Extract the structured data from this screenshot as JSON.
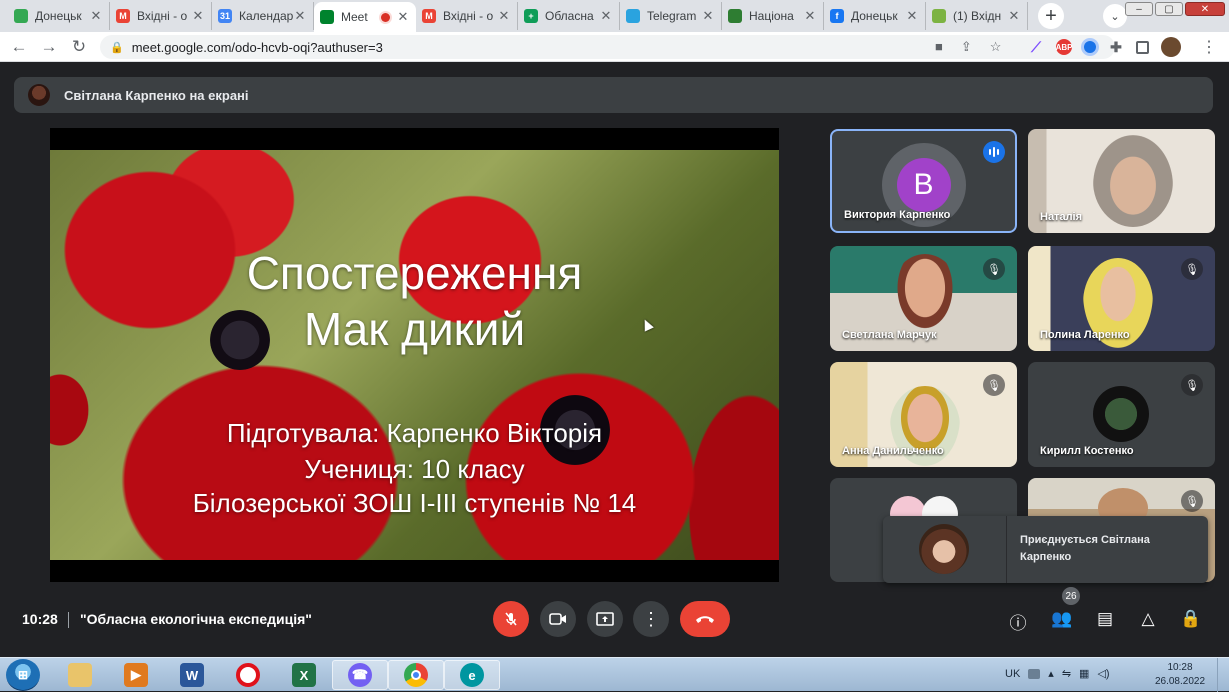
{
  "browser": {
    "tabs": [
      {
        "title": "Донецьк",
        "icon": "shield-favicon",
        "color": "#34a853",
        "glyph": ""
      },
      {
        "title": "Вхідні - о",
        "icon": "gmail-favicon",
        "color": "#ea4335",
        "glyph": "M"
      },
      {
        "title": "Календар",
        "icon": "calendar-favicon",
        "color": "#4285f4",
        "glyph": "31"
      },
      {
        "title": "Meet",
        "icon": "meet-favicon",
        "color": "#00832d",
        "glyph": "",
        "active": true
      },
      {
        "title": "Вхідні - о",
        "icon": "gmail-favicon",
        "color": "#ea4335",
        "glyph": "M"
      },
      {
        "title": "Обласна",
        "icon": "sheets-favicon",
        "color": "#0f9d58",
        "glyph": "+"
      },
      {
        "title": "Telegram",
        "icon": "telegram-favicon",
        "color": "#2aa3df",
        "glyph": ""
      },
      {
        "title": "Націона",
        "icon": "eco-favicon",
        "color": "#2e7d32",
        "glyph": ""
      },
      {
        "title": "Донецьк",
        "icon": "facebook-favicon",
        "color": "#1877f2",
        "glyph": "f"
      },
      {
        "title": "(1) Вхідн",
        "icon": "mail-favicon",
        "color": "#7cb342",
        "glyph": ""
      }
    ],
    "url": "meet.google.com/odo-hcvb-oqi?authuser=3"
  },
  "meet": {
    "banner": "Світлана Карпенко на екрані",
    "slide": {
      "title_line1": "Спостереження",
      "title_line2": "Мак дикий",
      "sub_line1": "Підготувала: Карпенко Вікторія",
      "sub_line2": "Учениця: 10 класу",
      "sub_line3": "Білозерської ЗОШ І-ІІІ ступенів № 14"
    },
    "participants": [
      {
        "name": "Виктория Карпенко",
        "initial": "B",
        "speaking": true
      },
      {
        "name": "Наталія"
      },
      {
        "name": "Светлана Марчук",
        "muted": true
      },
      {
        "name": "Полина Ларенко",
        "muted": true
      },
      {
        "name": "Анна Данильченко",
        "muted": true
      },
      {
        "name": "Кирилл Костенко",
        "muted": true
      }
    ],
    "join_toast": "Приєднується Світлана Карпенко",
    "time": "10:28",
    "meeting_title": "\"Обласна екологічна експедиція\"",
    "participant_count": "26"
  },
  "taskbar": {
    "lang": "UK",
    "clock_time": "10:28",
    "clock_date": "26.08.2022"
  }
}
